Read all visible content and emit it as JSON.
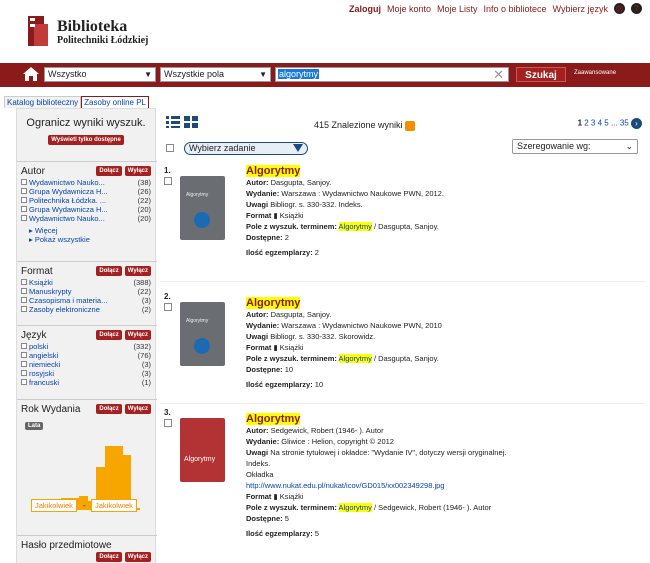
{
  "topnav": {
    "login": "Zaloguj",
    "account": "Moje konto",
    "lists": "Moje Listy",
    "info": "Info o bibliotece",
    "lang": "Wybierz język",
    "globe_icon": "globe-icon",
    "help_icon": "help-icon"
  },
  "logo": {
    "line1": "Biblioteka",
    "line2": "Politechniki Łódzkiej"
  },
  "search": {
    "scope": "Wszystko",
    "field": "Wszystkie pola",
    "query": "algorytmy",
    "button": "Szukaj",
    "advanced": "Zaawansowane",
    "home_icon": "home-icon"
  },
  "tabs": [
    {
      "label": "Katalog biblioteczny"
    },
    {
      "label": "Zasoby online PL"
    }
  ],
  "sidebar": {
    "title": "Ogranicz wyniki wyszuk.",
    "available_btn": "Wyświetl tylko dostępne",
    "include": "Dołącz",
    "exclude": "Wyłącz",
    "author": {
      "title": "Autor",
      "items": [
        {
          "label": "Wydawnictwo Nauko...",
          "count": "(38)"
        },
        {
          "label": "Grupa Wydawnicza H...",
          "count": "(26)"
        },
        {
          "label": "Politechnika Łódzka. ...",
          "count": "(22)"
        },
        {
          "label": "Grupa Wydawnicza H...",
          "count": "(20)"
        },
        {
          "label": "Wydawnictwo Nauko...",
          "count": "(20)"
        }
      ],
      "more": "▸ Więcej",
      "show_all": "▸ Pokaż wszystkie"
    },
    "format": {
      "title": "Format",
      "items": [
        {
          "label": "Książki",
          "count": "(388)"
        },
        {
          "label": "Manuskrypty",
          "count": "(22)"
        },
        {
          "label": "Czasopisma i materia...",
          "count": "(3)"
        },
        {
          "label": "Zasoby elektroniczne",
          "count": "(2)"
        }
      ]
    },
    "lang": {
      "title": "Język",
      "items": [
        {
          "label": "polski",
          "count": "(332)"
        },
        {
          "label": "angielski",
          "count": "(76)"
        },
        {
          "label": "niemiecki",
          "count": "(3)"
        },
        {
          "label": "rosyjski",
          "count": "(3)"
        },
        {
          "label": "francuski",
          "count": "(1)"
        }
      ]
    },
    "year": {
      "title": "Rok Wydania",
      "years_btn": "Lata",
      "from": "Jakikolwiek",
      "to": "Jakikolwiek",
      "dash": "-"
    },
    "subject": {
      "title": "Hasło przedmiotowe"
    }
  },
  "main": {
    "count": "415 Znalezione wyniki",
    "pages": {
      "current": "1",
      "others": "2 3 4 5",
      "dots": "...",
      "last": "35"
    },
    "task": "Wybierz zadanie",
    "sort": "Szeregowanie wg:",
    "records": [
      {
        "num": "1.",
        "cover": "Algorytmy",
        "title": "Algorytmy",
        "author_l": "Autor:",
        "author": "Dasgupta, Sanjoy.",
        "pub_l": "Wydanie:",
        "pub": "Warszawa : Wydawnictwo Naukowe PWN, 2012.",
        "notes_l": "Uwagi",
        "notes": "Bibliogr. s. 330-332. Indeks.",
        "format_l": "Format",
        "format": "Książki",
        "field_l": "Pole z wyszuk. terminem:",
        "field_hl": "Algorytmy",
        "field_rest": " / Dasgupta, Sanjoy.",
        "avail_l": "Dostępne:",
        "avail": "2",
        "copies_l": "Ilość egzemplarzy:",
        "copies": "2"
      },
      {
        "num": "2.",
        "cover": "Algorytmy",
        "title": "Algorytmy",
        "author_l": "Autor:",
        "author": "Dasgupta, Sanjoy.",
        "pub_l": "Wydanie:",
        "pub": "Warszawa : Wydawnictwo Naukowe PWN, 2010",
        "notes_l": "Uwagi",
        "notes": "Bibliogr. s. 330-332. Skorowidz.",
        "format_l": "Format",
        "format": "Książki",
        "field_l": "Pole z wyszuk. terminem:",
        "field_hl": "Algorytmy",
        "field_rest": " / Dasgupta, Sanjoy.",
        "avail_l": "Dostępne:",
        "avail": "10",
        "copies_l": "Ilość egzemplarzy:",
        "copies": "10"
      },
      {
        "num": "3.",
        "cover": "Algorytmy",
        "title": "Algorytmy",
        "author_l": "Autor:",
        "author": "Sedgewick, Robert (1946- ). Autor",
        "pub_l": "Wydanie:",
        "pub": "Gliwice : Helion, copyright © 2012",
        "notes_l": "Uwagi",
        "notes": "Na stronie tytułowej i okładce: \"Wydanie IV\", dotyczy wersji oryginalnej.",
        "notes2": "Indeks.",
        "notes3": "Okładka",
        "link": "http://www.nukat.edu.pl/nukat/icov/GD015/xx002349298.jpg",
        "format_l": "Format",
        "format": "Książki",
        "field_l": "Pole z wyszuk. terminem:",
        "field_hl": "Algorytmy",
        "field_rest": " / Sedgewick, Robert (1946- ). Autor",
        "avail_l": "Dostępne:",
        "avail": "5",
        "copies_l": "Ilość egzemplarzy:",
        "copies": "5"
      }
    ]
  },
  "histogram": [
    0.03,
    0.03,
    0.03,
    0.15,
    0.15,
    0.18,
    0.12,
    0.55,
    0.82,
    0.82,
    0.7,
    0.03
  ]
}
